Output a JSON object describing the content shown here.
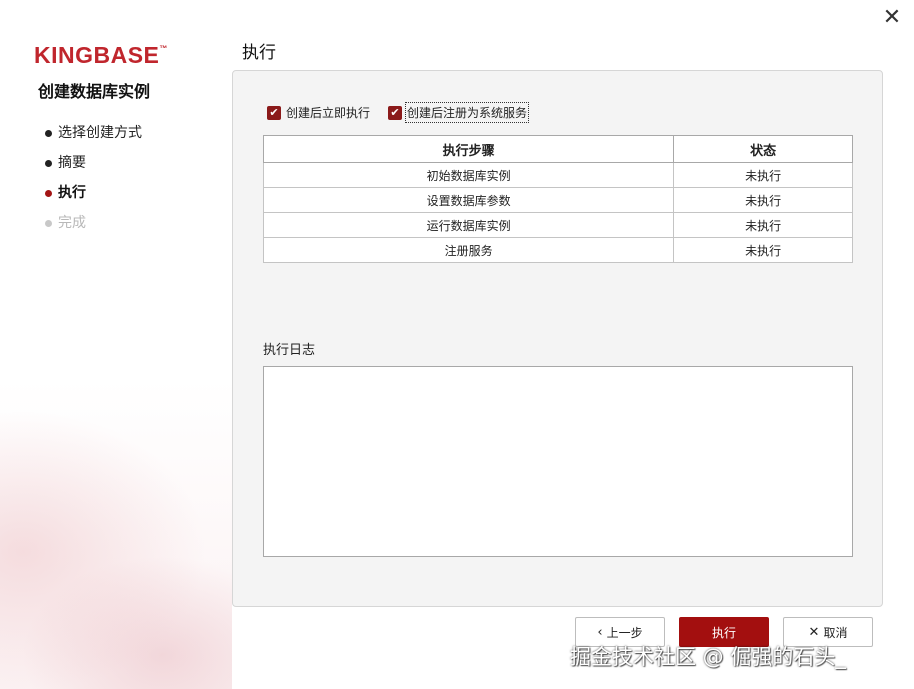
{
  "window": {
    "close_glyph": "✕"
  },
  "brand": {
    "logo_text": "KINGBASE",
    "logo_tm": "™",
    "color": "#c0262d"
  },
  "sidebar": {
    "title": "创建数据库实例",
    "steps": [
      {
        "label": "选择创建方式",
        "state": "done"
      },
      {
        "label": "摘要",
        "state": "done"
      },
      {
        "label": "执行",
        "state": "active"
      },
      {
        "label": "完成",
        "state": "disabled"
      }
    ]
  },
  "main": {
    "page_title": "执行",
    "options": [
      {
        "label": "创建后立即执行",
        "checked": true
      },
      {
        "label": "创建后注册为系统服务",
        "checked": true
      }
    ],
    "table": {
      "headers": [
        "执行步骤",
        "状态"
      ],
      "rows": [
        [
          "初始数据库实例",
          "未执行"
        ],
        [
          "设置数据库参数",
          "未执行"
        ],
        [
          "运行数据库实例",
          "未执行"
        ],
        [
          "注册服务",
          "未执行"
        ]
      ]
    },
    "log_label": "执行日志",
    "log_content": ""
  },
  "footer": {
    "prev_label": "上一步",
    "exec_label": "执行",
    "cancel_label": "取消",
    "prev_icon": "chevron-left-icon",
    "cancel_icon": "close-icon",
    "accent": "#a30f0f"
  },
  "watermark": "掘金技术社区 @ 倔强的石头_"
}
